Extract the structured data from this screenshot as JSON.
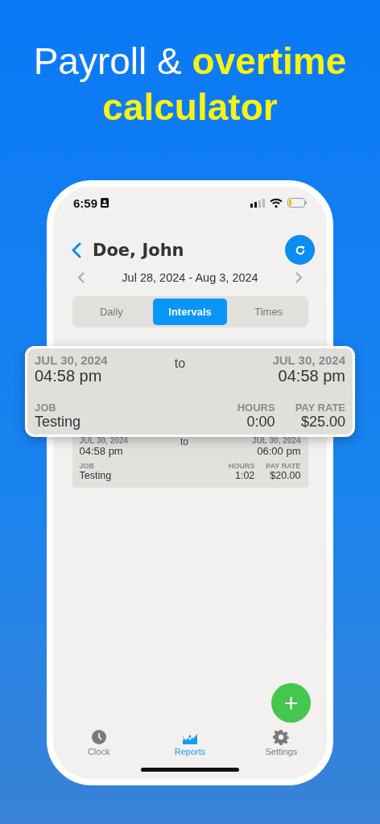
{
  "headline": "Payroll & **overtime calculator**",
  "status_bar": {
    "time": "6:59"
  },
  "header": {
    "title": "Doe, John"
  },
  "date_range": "Jul 28, 2024 - Aug 3, 2024",
  "tabs": [
    {
      "label": "Daily",
      "selected": false
    },
    {
      "label": "Intervals",
      "selected": true
    },
    {
      "label": "Times",
      "selected": false
    }
  ],
  "highlighted_card": {
    "start_date": "JUL 30, 2024",
    "start_time": "04:58 pm",
    "to": "to",
    "end_date": "JUL 30, 2024",
    "end_time": "04:58 pm",
    "job_label": "JOB",
    "job": "Testing",
    "hours_label": "HOURS",
    "hours": "0:00",
    "rate_label": "PAY RATE",
    "rate": "$25.00"
  },
  "cards": [
    {
      "start_date": "JUL 30, 2024",
      "start_time": "04:58 pm",
      "to": "to",
      "end_date": "JUL 30, 2024",
      "end_time": "06:00 pm",
      "job_label": "JOB",
      "job": "Testing",
      "hours_label": "HOURS",
      "hours": "1:02",
      "rate_label": "PAY RATE",
      "rate": "$20.00"
    }
  ],
  "add_button": "+",
  "nav": [
    {
      "label": "Clock",
      "selected": false
    },
    {
      "label": "Reports",
      "selected": true
    },
    {
      "label": "Settings",
      "selected": false
    }
  ]
}
